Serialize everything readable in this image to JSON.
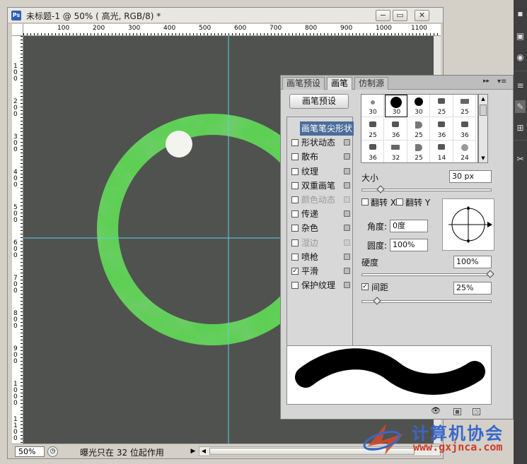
{
  "document": {
    "badge": "Ps",
    "title": "未标题-1 @ 50% ( 高光, RGB/8) *",
    "min_label": "−",
    "restore_label": "▭",
    "close_label": "✕"
  },
  "rulers": {
    "top": [
      "100",
      "200",
      "300",
      "400",
      "500",
      "600",
      "700",
      "800",
      "900",
      "1000",
      "1100"
    ],
    "left": [
      "1\n0\n0",
      "2\n0\n0",
      "3\n0\n0",
      "4\n0\n0",
      "5\n0\n0",
      "6\n0\n0",
      "7\n0\n0",
      "8\n0\n0",
      "9\n0\n0",
      "1\n0\n0\n0",
      "1\n1\n0\n0"
    ]
  },
  "status": {
    "zoom": "50%",
    "message": "曝光只在 32 位起作用",
    "arrow": "▶",
    "scroll_left": "◀"
  },
  "brush_panel": {
    "tabs": [
      "画笔预设",
      "画笔",
      "仿制源"
    ],
    "active_tab": "画笔",
    "menu_collapse": "▸▸",
    "menu_options": "▾≡",
    "presets_button": "画笔预设",
    "options": [
      {
        "label": "画笔笔尖形状",
        "checked": false,
        "has_checkbox": false,
        "locked": false,
        "disabled": false,
        "selected": true
      },
      {
        "label": "形状动态",
        "checked": false,
        "has_checkbox": true,
        "locked": true,
        "disabled": false,
        "selected": false
      },
      {
        "label": "散布",
        "checked": false,
        "has_checkbox": true,
        "locked": true,
        "disabled": false,
        "selected": false
      },
      {
        "label": "纹理",
        "checked": false,
        "has_checkbox": true,
        "locked": true,
        "disabled": false,
        "selected": false
      },
      {
        "label": "双重画笔",
        "checked": false,
        "has_checkbox": true,
        "locked": true,
        "disabled": false,
        "selected": false
      },
      {
        "label": "颜色动态",
        "checked": false,
        "has_checkbox": true,
        "locked": true,
        "disabled": true,
        "selected": false
      },
      {
        "label": "传递",
        "checked": false,
        "has_checkbox": true,
        "locked": true,
        "disabled": false,
        "selected": false
      },
      {
        "label": "杂色",
        "checked": false,
        "has_checkbox": true,
        "locked": true,
        "disabled": false,
        "selected": false
      },
      {
        "label": "湿边",
        "checked": false,
        "has_checkbox": true,
        "locked": true,
        "disabled": true,
        "selected": false
      },
      {
        "label": "喷枪",
        "checked": false,
        "has_checkbox": true,
        "locked": true,
        "disabled": false,
        "selected": false
      },
      {
        "label": "平滑",
        "checked": true,
        "has_checkbox": true,
        "locked": true,
        "disabled": false,
        "selected": false
      },
      {
        "label": "保护纹理",
        "checked": false,
        "has_checkbox": true,
        "locked": true,
        "disabled": false,
        "selected": false
      }
    ],
    "tips": [
      {
        "size": "30",
        "shape": "soft-dot"
      },
      {
        "size": "30",
        "shape": "big-dot"
      },
      {
        "size": "30",
        "shape": "dot"
      },
      {
        "size": "25",
        "shape": "brush"
      },
      {
        "size": "25",
        "shape": "flat"
      },
      {
        "size": "25",
        "shape": "brush"
      },
      {
        "size": "36",
        "shape": "brush"
      },
      {
        "size": "25",
        "shape": "fan"
      },
      {
        "size": "36",
        "shape": "brush"
      },
      {
        "size": "36",
        "shape": "brush"
      },
      {
        "size": "36",
        "shape": "brush"
      },
      {
        "size": "32",
        "shape": "flat"
      },
      {
        "size": "25",
        "shape": "fan"
      },
      {
        "size": "14",
        "shape": "brush"
      },
      {
        "size": "24",
        "shape": "star"
      }
    ],
    "size_label": "大小",
    "size_value": "30 px",
    "flip_x_label": "翻转 X",
    "flip_y_label": "翻转 Y",
    "angle_label": "角度:",
    "angle_value": "0度",
    "roundness_label": "圆度:",
    "roundness_value": "100%",
    "hardness_label": "硬度",
    "hardness_value": "100%",
    "spacing_label": "间距",
    "spacing_value": "25%",
    "spacing_checked": "✓",
    "check_mark": "✓",
    "scroll_up": "▲",
    "scroll_down": "▼"
  },
  "watermark": {
    "text": "计算机协会",
    "url": "www.gxjnca.com"
  },
  "colors": {
    "canvas": "#505250",
    "ring": "#44c040",
    "guide": "#5ad3e0",
    "selection_highlight": "#4c6c9a"
  }
}
